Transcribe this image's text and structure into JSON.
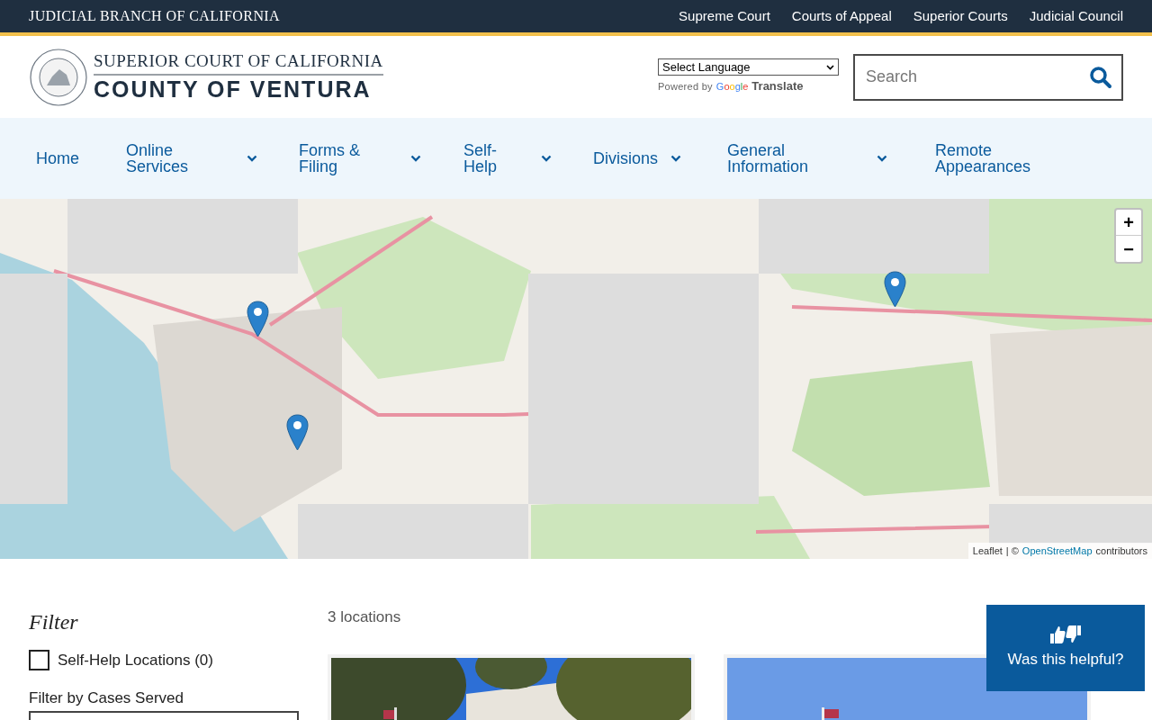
{
  "top_bar": {
    "title": "JUDICIAL BRANCH OF CALIFORNIA",
    "links": [
      "Supreme Court",
      "Courts of Appeal",
      "Superior Courts",
      "Judicial Council"
    ]
  },
  "header": {
    "court_name": "SUPERIOR COURT OF CALIFORNIA",
    "county": "COUNTY OF VENTURA",
    "language_select": "Select Language",
    "powered_by": "Powered by",
    "google": "Google",
    "translate": "Translate",
    "search": {
      "placeholder": "Search"
    }
  },
  "nav": [
    {
      "label": "Home",
      "dropdown": false
    },
    {
      "label": "Online Services",
      "dropdown": true
    },
    {
      "label": "Forms & Filing",
      "dropdown": true
    },
    {
      "label": "Self-Help",
      "dropdown": true
    },
    {
      "label": "Divisions",
      "dropdown": true
    },
    {
      "label": "General Information",
      "dropdown": true
    },
    {
      "label": "Remote Appearances",
      "dropdown": false
    }
  ],
  "map": {
    "zoom_in": "+",
    "zoom_out": "−",
    "attribution": {
      "leaflet": "Leaflet",
      "separator": "| ©",
      "osm": "OpenStreetMap",
      "suffix": "contributors"
    }
  },
  "filter": {
    "title": "Filter",
    "checkboxes": [
      {
        "label": "Self-Help Locations (0)",
        "checked": false
      }
    ],
    "cases_label": "Filter by Cases Served"
  },
  "results": {
    "count": "3 locations"
  },
  "feedback": {
    "label": "Was this helpful?"
  }
}
